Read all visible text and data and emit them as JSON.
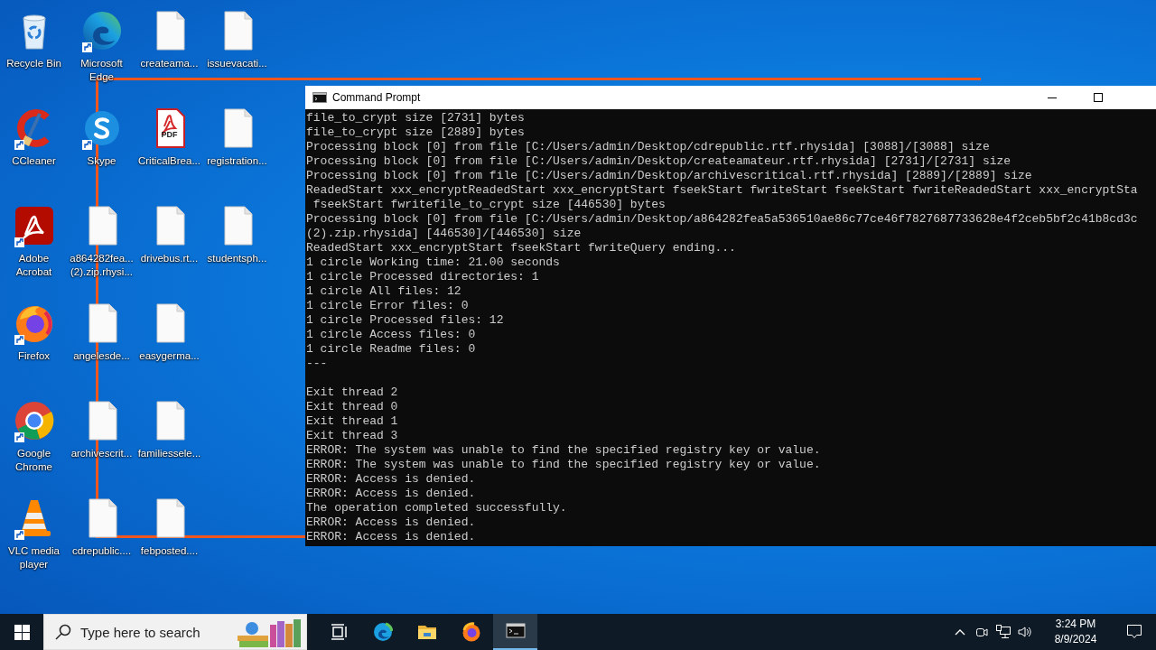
{
  "desktop_icons": [
    {
      "label": "Recycle Bin",
      "kind": "recycle-bin",
      "shortcut": false
    },
    {
      "label": "CCleaner",
      "kind": "ccleaner",
      "shortcut": true
    },
    {
      "label": "Adobe Acrobat",
      "kind": "acrobat",
      "shortcut": true
    },
    {
      "label": "Firefox",
      "kind": "firefox",
      "shortcut": true
    },
    {
      "label": "Google Chrome",
      "kind": "chrome",
      "shortcut": true
    },
    {
      "label": "VLC media player",
      "kind": "vlc",
      "shortcut": true
    },
    {
      "label": "Microsoft Edge",
      "kind": "edge",
      "shortcut": true
    },
    {
      "label": "Skype",
      "kind": "skype",
      "shortcut": true
    },
    {
      "label": "a864282fea... (2).zip.rhysi...",
      "kind": "document",
      "shortcut": false
    },
    {
      "label": "angelesde...",
      "kind": "document",
      "shortcut": false
    },
    {
      "label": "archivescrit...",
      "kind": "document",
      "shortcut": false
    },
    {
      "label": "cdrepublic....",
      "kind": "document",
      "shortcut": false
    },
    {
      "label": "createama...",
      "kind": "document",
      "shortcut": false
    },
    {
      "label": "CriticalBrea...",
      "kind": "pdf",
      "badge": "PDF",
      "shortcut": false
    },
    {
      "label": "drivebus.rt...",
      "kind": "document",
      "shortcut": false
    },
    {
      "label": "easygerma...",
      "kind": "document",
      "shortcut": false
    },
    {
      "label": "familiessele...",
      "kind": "document",
      "shortcut": false
    },
    {
      "label": "febposted....",
      "kind": "document",
      "shortcut": false
    },
    {
      "label": "issuevacati...",
      "kind": "document",
      "shortcut": false
    },
    {
      "label": "registration...",
      "kind": "document",
      "shortcut": false
    },
    {
      "label": "studentsph...",
      "kind": "document",
      "shortcut": false
    }
  ],
  "console": {
    "title": "Command Prompt",
    "blocks": [
      [
        "file_to_crypt size [2731] bytes",
        "file_to_crypt size [2889] bytes",
        "Processing block [0] from file [C:/Users/admin/Desktop/cdrepublic.rtf.rhysida] [3088]/[3088] size",
        "Processing block [0] from file [C:/Users/admin/Desktop/createamateur.rtf.rhysida] [2731]/[2731] size",
        "Processing block [0] from file [C:/Users/admin/Desktop/archivescritical.rtf.rhysida] [2889]/[2889] size",
        "ReadedStart xxx_encryptReadedStart xxx_encryptStart fseekStart fwriteStart fseekStart fwriteReadedStart xxx_encryptSta",
        " fseekStart fwritefile_to_crypt size [446530] bytes",
        "Processing block [0] from file [C:/Users/admin/Desktop/a864282fea5a536510ae86c77ce46f7827687733628e4f2ceb5bf2c41b8cd3c",
        "(2).zip.rhysida] [446530]/[446530] size",
        "ReadedStart xxx_encryptStart fseekStart fwriteQuery ending...",
        "1 circle Working time: 21.00 seconds",
        "1 circle Processed directories: 1",
        "1 circle All files: 12",
        "1 circle Error files: 0",
        "1 circle Processed files: 12",
        "1 circle Access files: 0",
        "1 circle Readme files: 0",
        "---"
      ],
      [
        "Exit thread 2",
        "Exit thread 0",
        "Exit thread 1",
        "Exit thread 3",
        "ERROR: The system was unable to find the specified registry key or value.",
        "ERROR: The system was unable to find the specified registry key or value.",
        "ERROR: Access is denied.",
        "ERROR: Access is denied.",
        "The operation completed successfully.",
        "ERROR: Access is denied.",
        "ERROR: Access is denied."
      ]
    ]
  },
  "taskbar": {
    "search": {
      "placeholder": "Type here to search"
    },
    "apps": [
      {
        "kind": "task-view",
        "active": false
      },
      {
        "kind": "edge",
        "active": false
      },
      {
        "kind": "folder",
        "active": false
      },
      {
        "kind": "firefox",
        "active": false
      },
      {
        "kind": "terminal",
        "active": true
      }
    ],
    "clock": {
      "time": "3:24 PM",
      "date": "8/9/2024"
    }
  }
}
